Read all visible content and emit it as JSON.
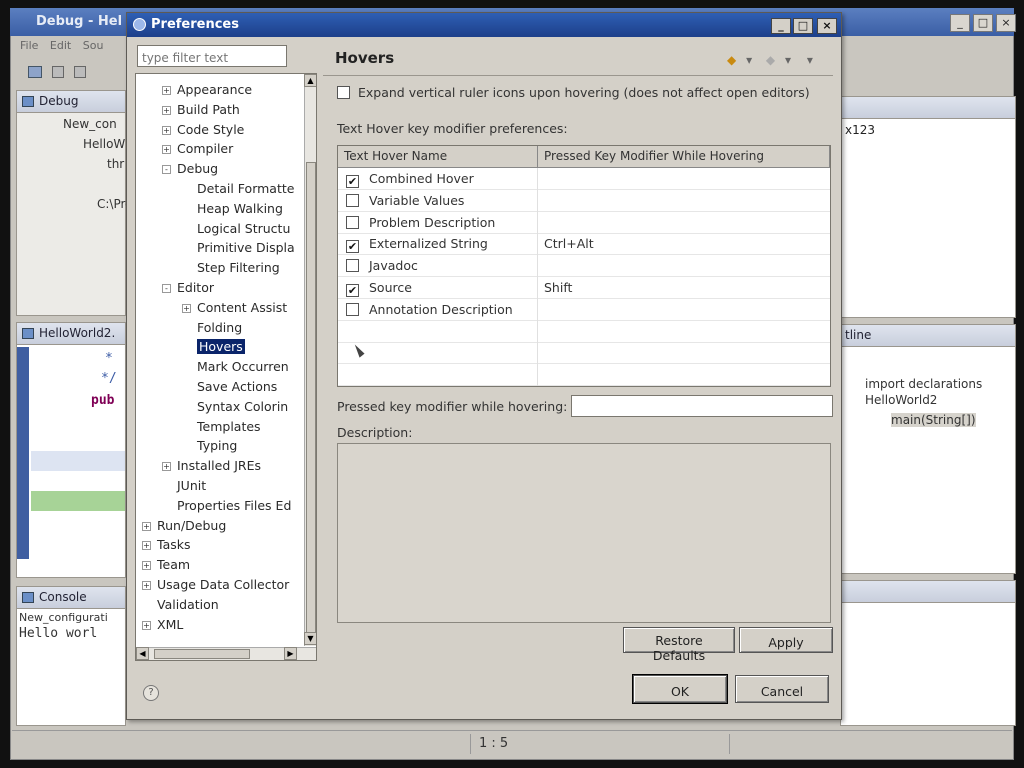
{
  "workbench": {
    "title": "Debug - Hel",
    "menu": [
      "File",
      "Edit",
      "Sou"
    ],
    "debug_view": {
      "tab_label": "Debug",
      "tree": [
        "New_con",
        "HelloW",
        "thr",
        "C:\\Pro"
      ]
    },
    "editor": {
      "tab_label": "HelloWorld2.",
      "lines": [
        "*",
        "*/",
        "pub"
      ]
    },
    "console": {
      "tab_label": "Console",
      "config": "New_configurati",
      "output": "Hello worl"
    },
    "right_panel_text": "x123",
    "outline": {
      "tab_label": "tline",
      "items": [
        "import declarations",
        "HelloWorld2",
        "main(String[])"
      ]
    },
    "status_position": "1 : 5"
  },
  "dialog": {
    "title": "Preferences",
    "filter_placeholder": "type filter text",
    "tree": [
      {
        "label": "Appearance",
        "depth": 1,
        "exp": "+"
      },
      {
        "label": "Build Path",
        "depth": 1,
        "exp": "+"
      },
      {
        "label": "Code Style",
        "depth": 1,
        "exp": "+"
      },
      {
        "label": "Compiler",
        "depth": 1,
        "exp": "+"
      },
      {
        "label": "Debug",
        "depth": 1,
        "exp": "-"
      },
      {
        "label": "Detail Formatte",
        "depth": 2,
        "exp": ""
      },
      {
        "label": "Heap Walking",
        "depth": 2,
        "exp": ""
      },
      {
        "label": "Logical Structu",
        "depth": 2,
        "exp": ""
      },
      {
        "label": "Primitive Displa",
        "depth": 2,
        "exp": ""
      },
      {
        "label": "Step Filtering",
        "depth": 2,
        "exp": ""
      },
      {
        "label": "Editor",
        "depth": 1,
        "exp": "-"
      },
      {
        "label": "Content Assist",
        "depth": 2,
        "exp": "+"
      },
      {
        "label": "Folding",
        "depth": 2,
        "exp": ""
      },
      {
        "label": "Hovers",
        "depth": 2,
        "exp": "",
        "selected": true
      },
      {
        "label": "Mark Occurren",
        "depth": 2,
        "exp": ""
      },
      {
        "label": "Save Actions",
        "depth": 2,
        "exp": ""
      },
      {
        "label": "Syntax Colorin",
        "depth": 2,
        "exp": ""
      },
      {
        "label": "Templates",
        "depth": 2,
        "exp": ""
      },
      {
        "label": "Typing",
        "depth": 2,
        "exp": ""
      },
      {
        "label": "Installed JREs",
        "depth": 1,
        "exp": "+"
      },
      {
        "label": "JUnit",
        "depth": 1,
        "exp": ""
      },
      {
        "label": "Properties Files Ed",
        "depth": 1,
        "exp": ""
      },
      {
        "label": "Run/Debug",
        "depth": 0,
        "exp": "+"
      },
      {
        "label": "Tasks",
        "depth": 0,
        "exp": "+"
      },
      {
        "label": "Team",
        "depth": 0,
        "exp": "+"
      },
      {
        "label": "Usage Data Collector",
        "depth": 0,
        "exp": "+"
      },
      {
        "label": "Validation",
        "depth": 0,
        "exp": ""
      },
      {
        "label": "XML",
        "depth": 0,
        "exp": "+"
      }
    ],
    "page": {
      "title": "Hovers",
      "expand_checkbox_label": "Expand vertical ruler icons upon hovering (does not affect open editors)",
      "expand_checked": false,
      "section_label": "Text Hover key modifier preferences:",
      "columns": [
        "Text Hover Name",
        "Pressed Key Modifier While Hovering"
      ],
      "rows": [
        {
          "name": "Combined Hover",
          "checked": true,
          "modifier": ""
        },
        {
          "name": "Variable Values",
          "checked": false,
          "modifier": ""
        },
        {
          "name": "Problem Description",
          "checked": false,
          "modifier": ""
        },
        {
          "name": "Externalized String",
          "checked": true,
          "modifier": "Ctrl+Alt"
        },
        {
          "name": "Javadoc",
          "checked": false,
          "modifier": ""
        },
        {
          "name": "Source",
          "checked": true,
          "modifier": "Shift"
        },
        {
          "name": "Annotation Description",
          "checked": false,
          "modifier": ""
        }
      ],
      "pressed_key_label": "Pressed key modifier while hovering:",
      "pressed_key_value": "",
      "description_label": "Description:"
    },
    "buttons": {
      "restore": "Restore Defaults",
      "apply": "Apply",
      "ok": "OK",
      "cancel": "Cancel"
    }
  }
}
